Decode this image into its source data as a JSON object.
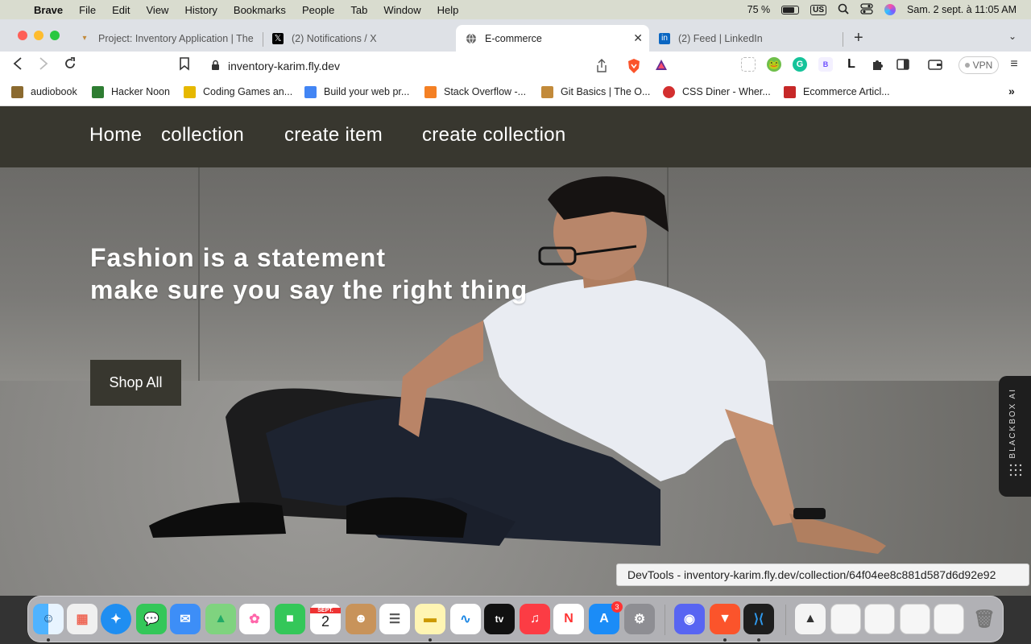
{
  "menubar": {
    "app": "Brave",
    "items": [
      "File",
      "Edit",
      "View",
      "History",
      "Bookmarks",
      "People",
      "Tab",
      "Window",
      "Help"
    ],
    "battery": "75 %",
    "keyboard": "US",
    "datetime": "Sam. 2 sept. à 11:05 AM"
  },
  "tabs": [
    {
      "title": "Project: Inventory Application | The",
      "icon": "odin-icon"
    },
    {
      "title": "(2) Notifications / X",
      "icon": "x-icon"
    },
    {
      "title": "E-commerce",
      "icon": "globe-icon",
      "active": true
    },
    {
      "title": "(2) Feed | LinkedIn",
      "icon": "linkedin-icon"
    }
  ],
  "toolbar": {
    "url": "inventory-karim.fly.dev",
    "vpn": "VPN"
  },
  "bookmarks": [
    {
      "label": "audiobook",
      "color": "#8b6a2f"
    },
    {
      "label": "Hacker Noon",
      "color": "#2e7d32"
    },
    {
      "label": "Coding Games an...",
      "color": "#e6b800"
    },
    {
      "label": "Build your web pr...",
      "color": "#4285f4"
    },
    {
      "label": "Stack Overflow -...",
      "color": "#f48024"
    },
    {
      "label": "Git Basics | The O...",
      "color": "#c28a3a"
    },
    {
      "label": "CSS Diner - Wher...",
      "color": "#d32f2f"
    },
    {
      "label": "Ecommerce Articl...",
      "color": "#c62828"
    }
  ],
  "site": {
    "nav": [
      "Home",
      "collection",
      "create item",
      "create collection"
    ],
    "hero_line1": "Fashion is a statement",
    "hero_line2": "make sure you say the right thing",
    "shop_button": "Shop All"
  },
  "blackbox": {
    "label": "BLACKBOX AI"
  },
  "devtools_tooltip": "DevTools - inventory-karim.fly.dev/collection/64f04ee8c881d587d6d92e92",
  "dock": {
    "calendar_month": "SEPT.",
    "calendar_day": "2",
    "appstore_badge": "3"
  },
  "colors": {
    "site_nav_bg": "#38372f",
    "button_bg": "#38372f",
    "accent_brave": "#fb542b"
  }
}
